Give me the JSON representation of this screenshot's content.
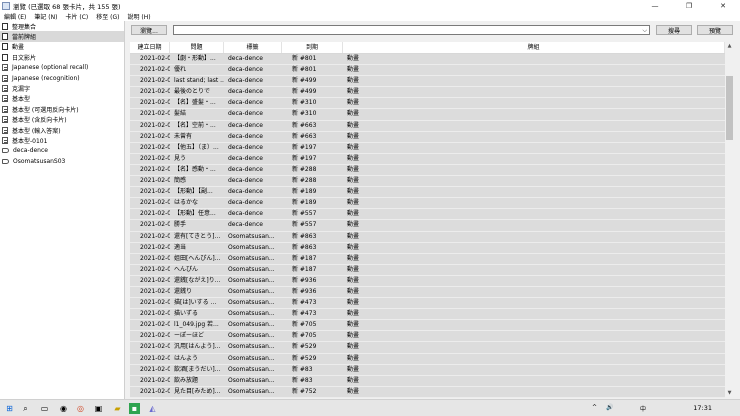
{
  "window": {
    "title": "瀏覽 (已選取 68 張卡片，共 155 張)",
    "controls": [
      "—",
      "❐",
      "✕"
    ]
  },
  "menu": [
    "編輯 (E)",
    "筆記 (N)",
    "卡片 (C)",
    "移至 (G)",
    "說明 (H)"
  ],
  "sidebar": [
    {
      "label": "整理集合",
      "icon": "deck",
      "selected": false
    },
    {
      "label": "當前牌組",
      "icon": "deck",
      "selected": true
    },
    {
      "label": "動畫",
      "icon": "deck",
      "selected": false
    },
    {
      "label": "日文影片",
      "icon": "deck",
      "selected": false
    },
    {
      "label": "Japanese (optional recall)",
      "icon": "filter",
      "selected": false
    },
    {
      "label": "Japanese (recognition)",
      "icon": "filter",
      "selected": false
    },
    {
      "label": "克漏字",
      "icon": "filter",
      "selected": false
    },
    {
      "label": "基本型",
      "icon": "filter",
      "selected": false
    },
    {
      "label": "基本型 (可選用反向卡片)",
      "icon": "filter",
      "selected": false
    },
    {
      "label": "基本型 (含反向卡片)",
      "icon": "filter",
      "selected": false
    },
    {
      "label": "基本型 (輸入答案)",
      "icon": "filter",
      "selected": false
    },
    {
      "label": "基本型-0101",
      "icon": "filter",
      "selected": false
    },
    {
      "label": "deca-dence",
      "icon": "tag",
      "selected": false
    },
    {
      "label": "OsomatsusanS03",
      "icon": "tag",
      "selected": false
    }
  ],
  "toolbar": {
    "search_button": "瀏覽...",
    "search_value": "",
    "preview_button": "預覽",
    "find_button": "搜尋"
  },
  "table": {
    "columns": [
      "建立日期",
      "問題",
      "標籤",
      "到期",
      "牌組"
    ],
    "rows": [
      [
        "2021-02-07",
        "【劇・形動】...",
        "deca-dence",
        "新 #801",
        "動畫"
      ],
      [
        "2021-02-07",
        "優れ",
        "deca-dence",
        "新 #801",
        "動畫"
      ],
      [
        "2021-02-07",
        "last stand; last ...",
        "deca-dence",
        "新 #499",
        "動畫"
      ],
      [
        "2021-02-07",
        "最後のとりで",
        "deca-dence",
        "新 #499",
        "動畫"
      ],
      [
        "2021-02-07",
        "【名】盛髪・...",
        "deca-dence",
        "新 #310",
        "動畫"
      ],
      [
        "2021-02-07",
        "髪結",
        "deca-dence",
        "新 #310",
        "動畫"
      ],
      [
        "2021-02-07",
        "【名】空前・...",
        "deca-dence",
        "新 #663",
        "動畫"
      ],
      [
        "2021-02-07",
        "未曾有",
        "deca-dence",
        "新 #663",
        "動畫"
      ],
      [
        "2021-02-07",
        "【他五】（ま）...",
        "deca-dence",
        "新 #197",
        "動畫"
      ],
      [
        "2021-02-07",
        "見う",
        "deca-dence",
        "新 #197",
        "動畫"
      ],
      [
        "2021-02-07",
        "【名】感動・...",
        "deca-dence",
        "新 #288",
        "動畫"
      ],
      [
        "2021-02-07",
        "簡感",
        "deca-dence",
        "新 #288",
        "動畫"
      ],
      [
        "2021-02-07",
        "【形動】【副...",
        "deca-dence",
        "新 #189",
        "動畫"
      ],
      [
        "2021-02-07",
        "はるかな",
        "deca-dence",
        "新 #189",
        "動畫"
      ],
      [
        "2021-02-07",
        "【形動】任意...",
        "deca-dence",
        "新 #557",
        "動畫"
      ],
      [
        "2021-02-07",
        "勝手",
        "deca-dence",
        "新 #557",
        "動畫"
      ],
      [
        "2021-02-07",
        "還有[てきとう]...",
        "Osomatsusan...",
        "新 #863",
        "動畫"
      ],
      [
        "2021-02-07",
        "適当",
        "Osomatsusan...",
        "新 #863",
        "動畫"
      ],
      [
        "2021-02-07",
        "姐田[へんぴん]...",
        "Osomatsusan...",
        "新 #187",
        "動畫"
      ],
      [
        "2021-02-07",
        "へんぴん",
        "Osomatsusan...",
        "新 #187",
        "動畫"
      ],
      [
        "2021-02-07",
        "還銭[ながえ]り...",
        "Osomatsusan...",
        "新 #936",
        "動畫"
      ],
      [
        "2021-02-07",
        "還銭り",
        "Osomatsusan...",
        "新 #936",
        "動畫"
      ],
      [
        "2021-02-07",
        "描[は]いする ...",
        "Osomatsusan...",
        "新 #473",
        "動畫"
      ],
      [
        "2021-02-07",
        "描いずる",
        "Osomatsusan...",
        "新 #473",
        "動畫"
      ],
      [
        "2021-02-07",
        "l1_049.jpg 若...",
        "Osomatsusan...",
        "新 #705",
        "動畫"
      ],
      [
        "2021-02-07",
        "ーぽーほど",
        "Osomatsusan...",
        "新 #705",
        "動畫"
      ],
      [
        "2021-02-07",
        "汎用[はんよう]...",
        "Osomatsusan...",
        "新 #529",
        "動畫"
      ],
      [
        "2021-02-07",
        "はんよう",
        "Osomatsusan...",
        "新 #529",
        "動畫"
      ],
      [
        "2021-02-07",
        "飲酒[まうだい]...",
        "Osomatsusan...",
        "新 #83",
        "動畫"
      ],
      [
        "2021-02-07",
        "飲み放題",
        "Osomatsusan...",
        "新 #83",
        "動畫"
      ],
      [
        "2021-02-07",
        "見た目[みため]...",
        "Osomatsusan...",
        "新 #752",
        "動畫"
      ]
    ]
  },
  "taskbar": {
    "clock": "17:31",
    "tray": [
      "^",
      "🔊",
      "中"
    ]
  }
}
